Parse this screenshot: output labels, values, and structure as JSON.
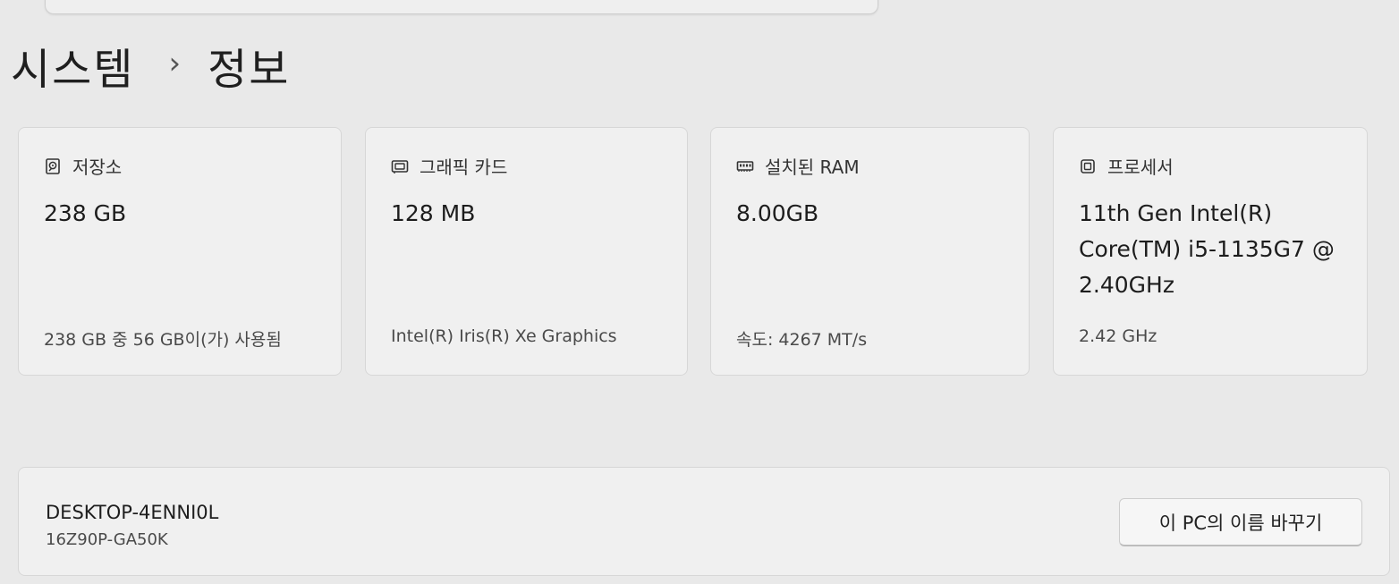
{
  "breadcrumb": {
    "parent": "시스템",
    "separator": "›",
    "current": "정보"
  },
  "specs": {
    "storage": {
      "icon": "storage-icon",
      "title": "저장소",
      "value": "238 GB",
      "detail": "238 GB 중 56 GB이(가) 사용됨"
    },
    "graphics": {
      "icon": "graphics-card-icon",
      "title": "그래픽 카드",
      "value": "128 MB",
      "detail": "Intel(R) Iris(R) Xe Graphics"
    },
    "ram": {
      "icon": "ram-icon",
      "title": "설치된 RAM",
      "value": "8.00GB",
      "detail": "속도: 4267 MT/s"
    },
    "processor": {
      "icon": "processor-icon",
      "title": "프로세서",
      "value": "11th Gen Intel(R) Core(TM) i5-1135G7 @ 2.40GHz",
      "detail": "2.42 GHz"
    }
  },
  "device": {
    "name": "DESKTOP-4ENNI0L",
    "model": "16Z90P-GA50K",
    "rename_label": "이 PC의 이름 바꾸기"
  }
}
